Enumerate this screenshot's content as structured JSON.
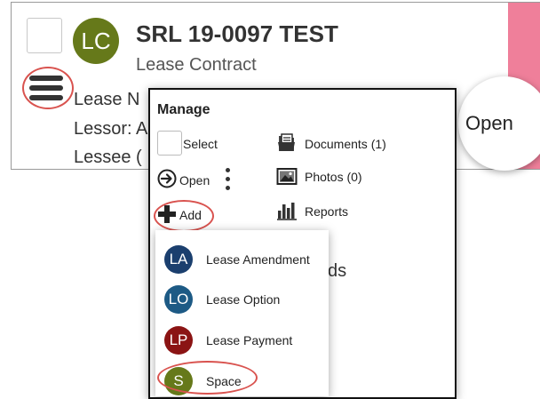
{
  "record": {
    "avatar_initials": "LC",
    "avatar_color": "#66791a",
    "title": "SRL 19-0097 TEST",
    "subtitle": "Lease Contract",
    "field_lines": [
      "Lease N",
      "Lessor: A",
      "Lessee ("
    ],
    "open_label": "Open",
    "status_color": "#ef7f9a"
  },
  "manage": {
    "title": "Manage",
    "select_label": "Select",
    "open_label": "Open",
    "add_label": "Add",
    "documents_label": "Documents (1)",
    "photos_label": "Photos (0)",
    "reports_label": "Reports"
  },
  "add_menu": {
    "items": [
      {
        "initials": "LA",
        "label": "Lease Amendment",
        "color": "#1b3f6e"
      },
      {
        "initials": "LO",
        "label": "Lease Option",
        "color": "#1d5a85"
      },
      {
        "initials": "LP",
        "label": "Lease Payment",
        "color": "#8b1414"
      },
      {
        "initials": "S",
        "label": "Space",
        "color": "#66791a"
      }
    ]
  },
  "behind_text": "ds",
  "highlight_color": "#d9534f",
  "icons": [
    "hamburger-menu-icon",
    "open-arrow-icon",
    "kebab-icon",
    "plus-icon",
    "document-icon",
    "photo-icon",
    "reports-icon"
  ]
}
